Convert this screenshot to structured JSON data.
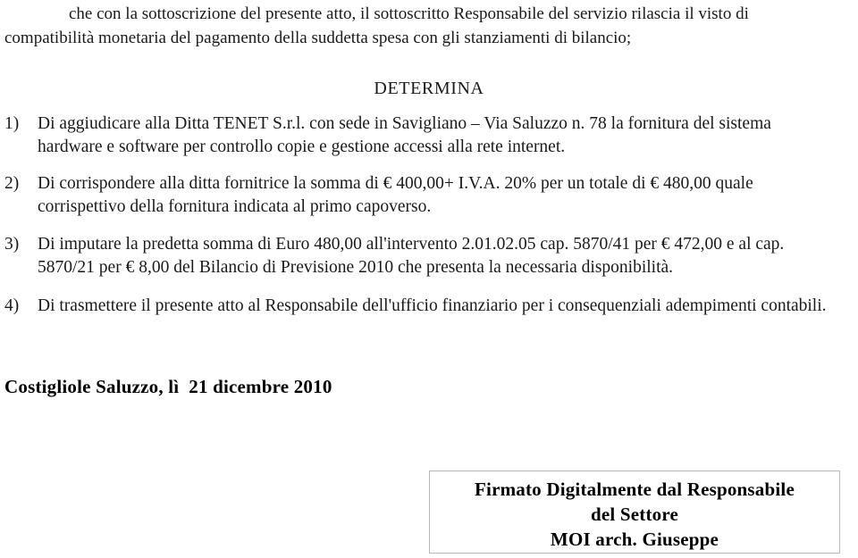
{
  "document": {
    "intro": {
      "line1": "che con la sottoscrizione del presente atto, il sottoscritto Responsabile del servizio rilascia il visto di",
      "line2": "compatibilità monetaria del pagamento della suddetta spesa con gli stanziamenti di bilancio;"
    },
    "heading": "DETERMINA",
    "items": [
      {
        "marker": "1)",
        "line1": "Di aggiudicare alla Ditta TENET S.r.l. con sede in Savigliano – Via Saluzzo n. 78 la fornitura del sistema",
        "line2": "hardware e software per controllo copie e gestione accessi alla rete internet."
      },
      {
        "marker": "2)",
        "line1": "Di corrispondere alla ditta fornitrice la somma di € 400,00+ I.V.A. 20% per un totale di € 480,00 quale",
        "line2": "corrispettivo della fornitura indicata al primo capoverso."
      },
      {
        "marker": "3)",
        "line1": "Di imputare la predetta somma di Euro 480,00 all'intervento 2.01.02.05 cap. 5870/41 per € 472,00 e al cap.",
        "line2": "5870/21 per € 8,00 del Bilancio di Previsione 2010 che presenta la necessaria disponibilità."
      },
      {
        "marker": "4)",
        "line1": "Di trasmettere il presente atto al Responsabile dell'ufficio finanziario per i consequenziali adempimenti contabili.",
        "line2": ""
      }
    ],
    "dateline": "Costigliole Saluzzo, lì  21 dicembre 2010",
    "signature_box": {
      "line1": "Firmato Digitalmente dal Responsabile",
      "line2": "del Settore",
      "line3": "MOI arch. Giuseppe"
    }
  },
  "colors": {
    "text": "#1a1a1a",
    "strong_text": "#000000",
    "box_border": "#b9b9b9",
    "page_background": "#ffffff"
  }
}
